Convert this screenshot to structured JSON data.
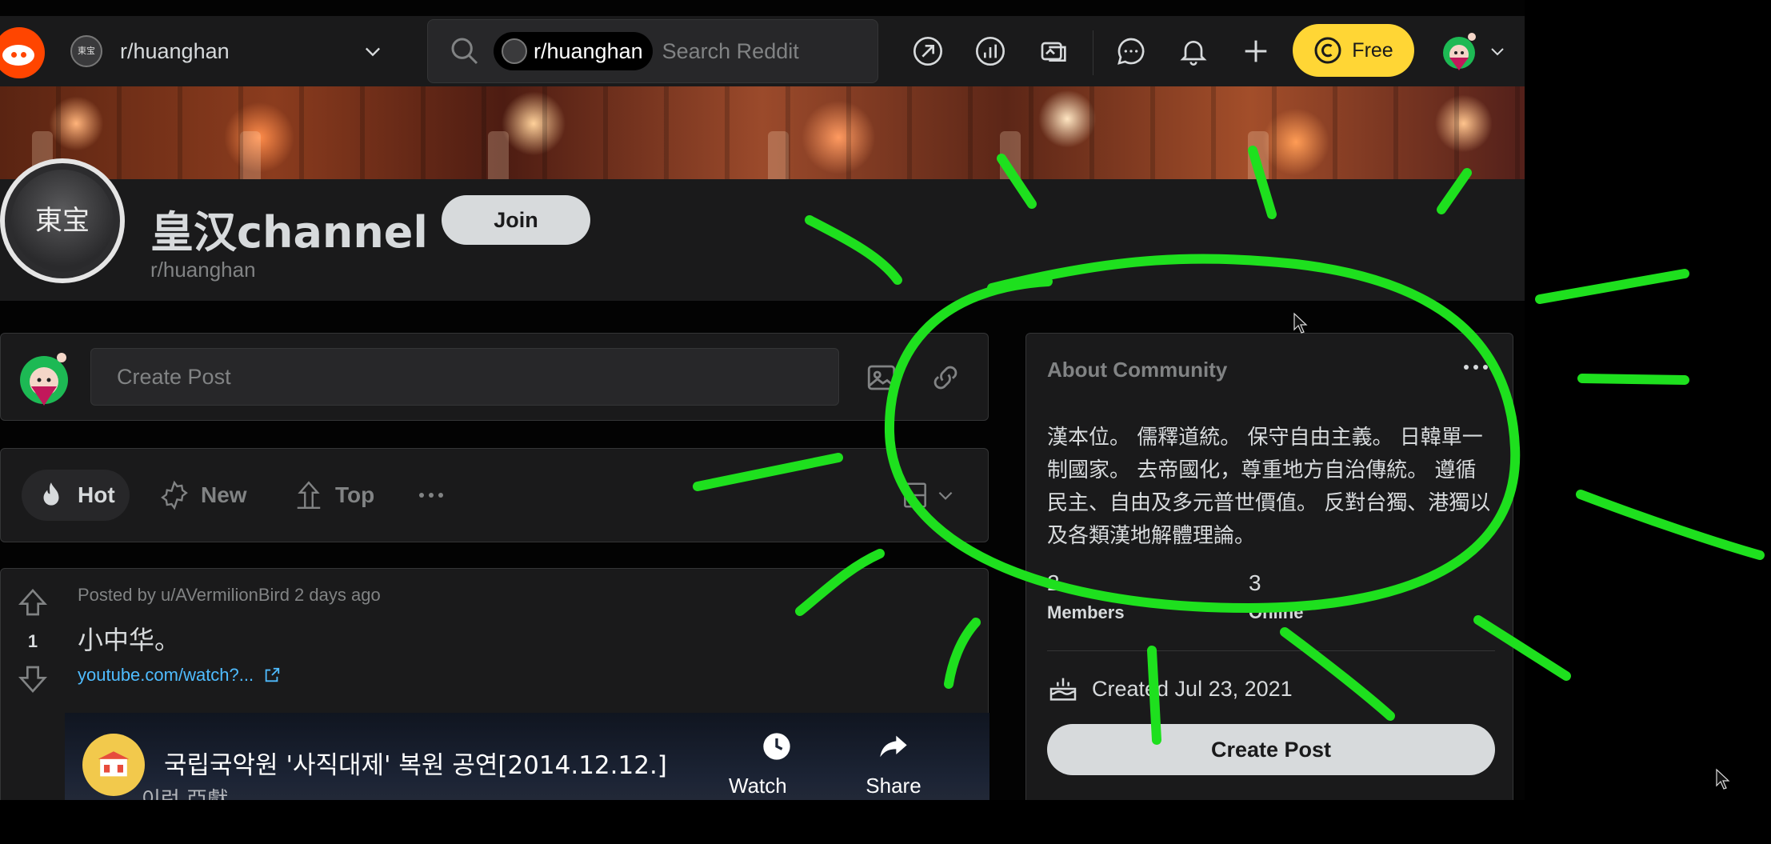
{
  "header": {
    "community_switcher_label": "r/huanghan",
    "search_chip_label": "r/huanghan",
    "search_placeholder": "Search Reddit",
    "free_label": "Free"
  },
  "community": {
    "icon_text": "東宝",
    "title": "皇汉channel",
    "name": "r/huanghan",
    "join_label": "Join"
  },
  "create_post": {
    "placeholder": "Create Post"
  },
  "sort": {
    "hot": "Hot",
    "new": "New",
    "top": "Top"
  },
  "post": {
    "meta": "Posted by u/AVermilionBird 2 days ago",
    "vote_count": "1",
    "title": "小中华。",
    "link_text": "youtube.com/watch?...",
    "video": {
      "title": "국립국악원 '사직대제' 복원 공연[2014.12.12.]",
      "watermark": "이런 亞獻",
      "watch_later": "Watch later",
      "share": "Share"
    }
  },
  "about": {
    "title": "About Community",
    "description": "漢本位。 儒釋道統。 保守自由主義。 日韓單一制國家。 去帝國化，尊重地方自治傳統。 遵循民主、自由及多元普世價值。 反對台獨、港獨以及各類漢地解體理論。",
    "members_count": "2",
    "members_label": "Members",
    "online_count": "3",
    "online_label": "Online",
    "created": "Created Jul 23, 2021",
    "create_post_label": "Create Post"
  },
  "colors": {
    "accent_orange": "#ff4500",
    "free_yellow": "#ffd635",
    "link_blue": "#4fbcff",
    "annotation_green": "#1ee01e"
  },
  "icons": [
    "reddit-logo-icon",
    "search-icon",
    "popular-icon",
    "stats-icon",
    "coins-icon",
    "chat-icon",
    "notification-icon",
    "plus-icon",
    "coin-icon",
    "image-icon",
    "link-icon",
    "hot-icon",
    "new-icon",
    "top-icon",
    "upvote-icon",
    "downvote-icon",
    "external-link-icon",
    "clock-icon",
    "share-icon",
    "cake-icon"
  ]
}
